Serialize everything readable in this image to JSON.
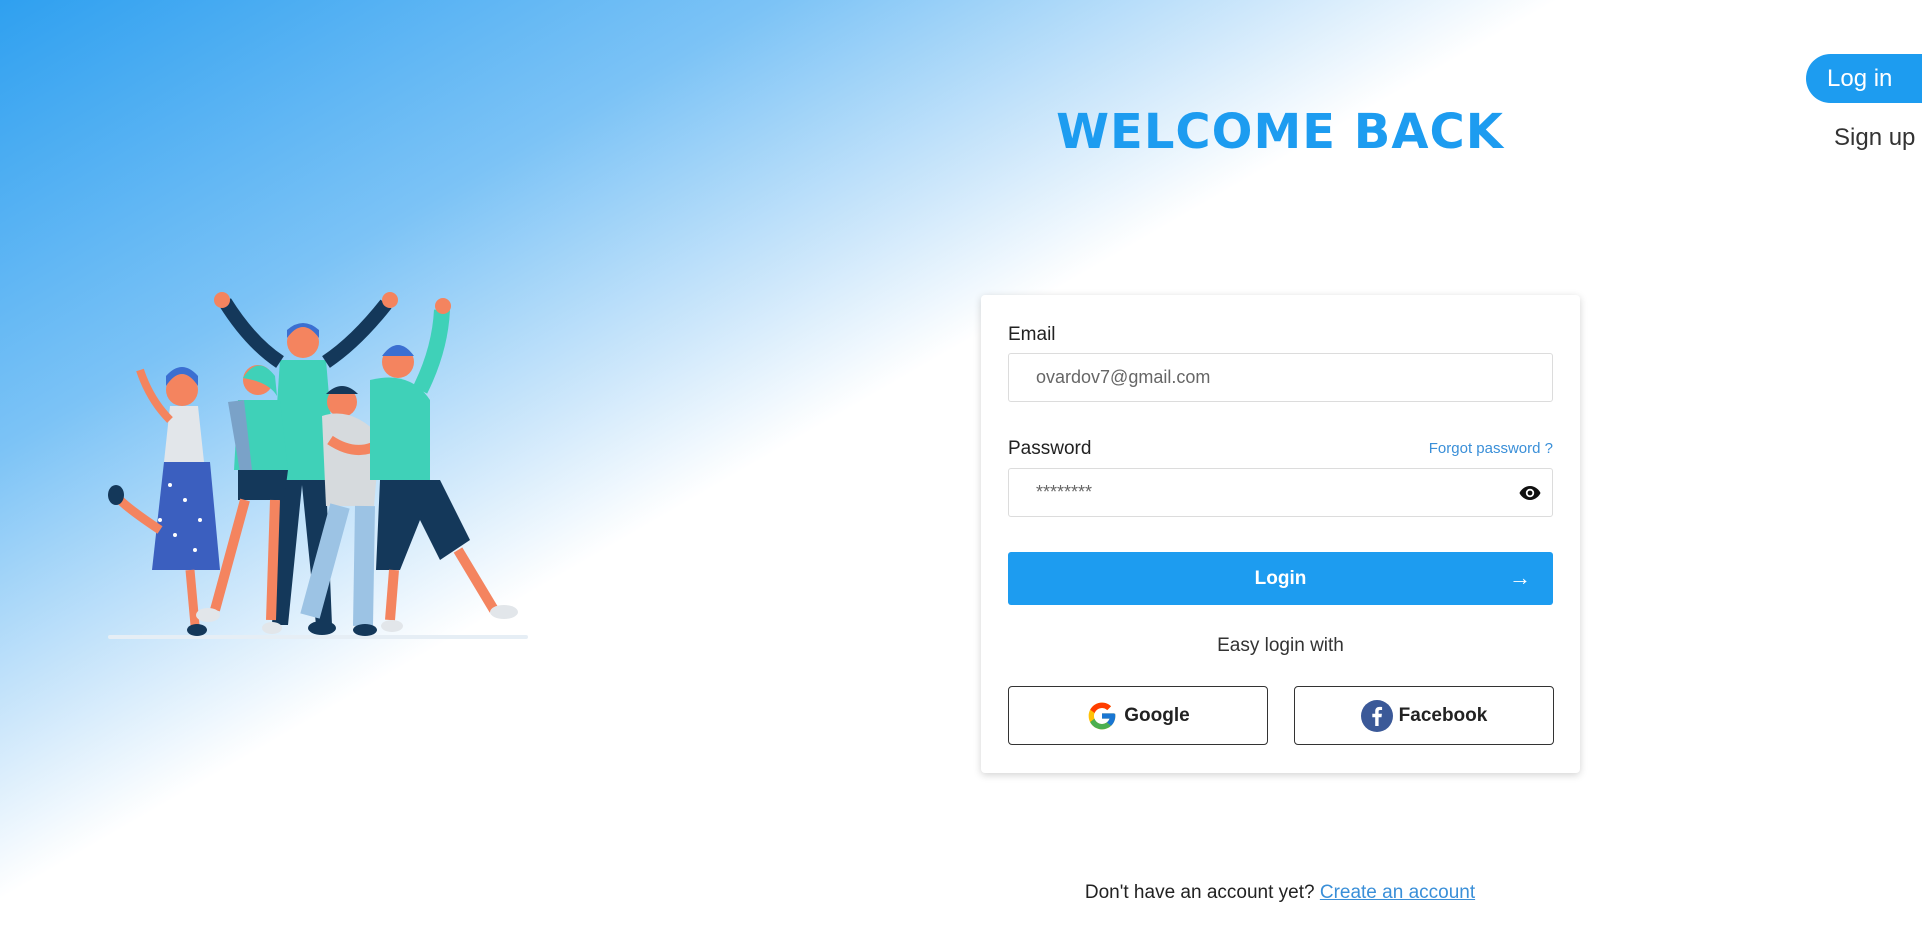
{
  "nav": {
    "login_label": "Log in",
    "signup_label": "Sign up"
  },
  "title": "WELCOME BACK",
  "form": {
    "email_label": "Email",
    "email_placeholder": "ovardov7@gmail.com",
    "password_label": "Password",
    "password_placeholder": "********",
    "forgot_label": "Forgot password ?",
    "login_label": "Login",
    "login_arrow": "→",
    "easy_login_label": "Easy login with",
    "google_label": "Google",
    "facebook_label": "Facebook"
  },
  "footer": {
    "prompt": "Don't have an account yet?",
    "link": "Create an account"
  },
  "colors": {
    "accent": "#1d9cf0",
    "link": "#3a8fd8"
  },
  "icons": [
    "eye-icon",
    "google-icon",
    "facebook-icon",
    "arrow-right-icon"
  ]
}
